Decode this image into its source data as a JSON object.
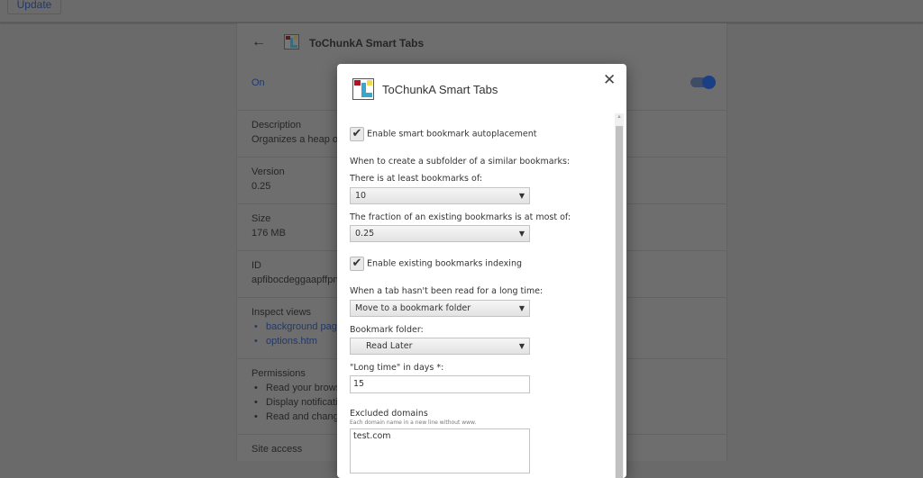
{
  "topbar": {
    "update_label": "Update"
  },
  "details": {
    "title": "ToChunkA Smart Tabs",
    "status": "On",
    "toggle_on": true,
    "description_label": "Description",
    "description": "Organizes a heap of",
    "version_label": "Version",
    "version": "0.25",
    "size_label": "Size",
    "size": "176 MB",
    "id_label": "ID",
    "id": "apfibocdeggaapffpn",
    "inspect_label": "Inspect views",
    "inspect_links": [
      "background page",
      "options.htm"
    ],
    "permissions_label": "Permissions",
    "permissions": [
      "Read your brows",
      "Display notificati",
      "Read and change"
    ],
    "site_access_label": "Site access"
  },
  "modal": {
    "title": "ToChunkA Smart Tabs",
    "enable_autoplacement": {
      "label": "Enable smart bookmark autoplacement",
      "checked": true
    },
    "subfolder_heading": "When to create a subfolder of a similar bookmarks:",
    "at_least_label": "There is at least bookmarks of:",
    "at_least_value": "10",
    "fraction_label": "The fraction of an existing bookmarks is at most of:",
    "fraction_value": "0.25",
    "enable_indexing": {
      "label": "Enable existing bookmarks indexing",
      "checked": true
    },
    "long_time_label": "When a tab hasn't been read for a long time:",
    "long_time_action": "Move to a bookmark folder",
    "folder_label": "Bookmark folder:",
    "folder_value": "Read Later",
    "days_label": "\"Long time\" in days *:",
    "days_value": "15",
    "excluded_label": "Excluded domains",
    "excluded_hint": "Each domain name in a new line without www.",
    "excluded_value": "test.com"
  }
}
